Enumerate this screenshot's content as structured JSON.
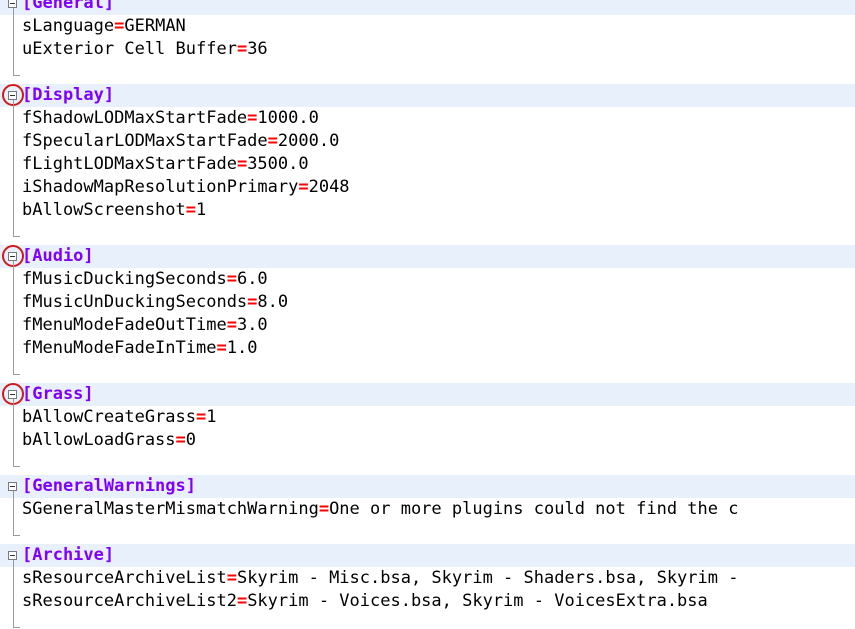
{
  "editor": {
    "sections": [
      {
        "name": "[General]",
        "circled": false,
        "entries": [
          {
            "key": "sLanguage",
            "value": "GERMAN"
          },
          {
            "key": "uExterior Cell Buffer",
            "value": "36"
          }
        ]
      },
      {
        "name": "[Display]",
        "circled": true,
        "entries": [
          {
            "key": "fShadowLODMaxStartFade",
            "value": "1000.0"
          },
          {
            "key": "fSpecularLODMaxStartFade",
            "value": "2000.0"
          },
          {
            "key": "fLightLODMaxStartFade",
            "value": "3500.0"
          },
          {
            "key": "iShadowMapResolutionPrimary",
            "value": "2048"
          },
          {
            "key": "bAllowScreenshot",
            "value": "1"
          }
        ]
      },
      {
        "name": "[Audio]",
        "circled": true,
        "entries": [
          {
            "key": "fMusicDuckingSeconds",
            "value": "6.0"
          },
          {
            "key": "fMusicUnDuckingSeconds",
            "value": "8.0"
          },
          {
            "key": "fMenuModeFadeOutTime",
            "value": "3.0"
          },
          {
            "key": "fMenuModeFadeInTime",
            "value": "1.0"
          }
        ]
      },
      {
        "name": "[Grass]",
        "circled": true,
        "entries": [
          {
            "key": "bAllowCreateGrass",
            "value": "1"
          },
          {
            "key": "bAllowLoadGrass",
            "value": "0"
          }
        ]
      },
      {
        "name": "[GeneralWarnings]",
        "circled": false,
        "entries": [
          {
            "key": "SGeneralMasterMismatchWarning",
            "value": "One or more plugins could not find the c"
          }
        ]
      },
      {
        "name": "[Archive]",
        "circled": false,
        "entries": [
          {
            "key": "sResourceArchiveList",
            "value": "Skyrim - Misc.bsa, Skyrim - Shaders.bsa, Skyrim - "
          },
          {
            "key": "sResourceArchiveList2",
            "value": "Skyrim - Voices.bsa, Skyrim - VoicesExtra.bsa"
          }
        ]
      }
    ],
    "equals_sign": "=",
    "colors": {
      "section_name": "#8000ff",
      "equals_sign": "#ff0000",
      "section_highlight": "#e8f0fb",
      "annotation_circle": "#d11a1a"
    }
  }
}
